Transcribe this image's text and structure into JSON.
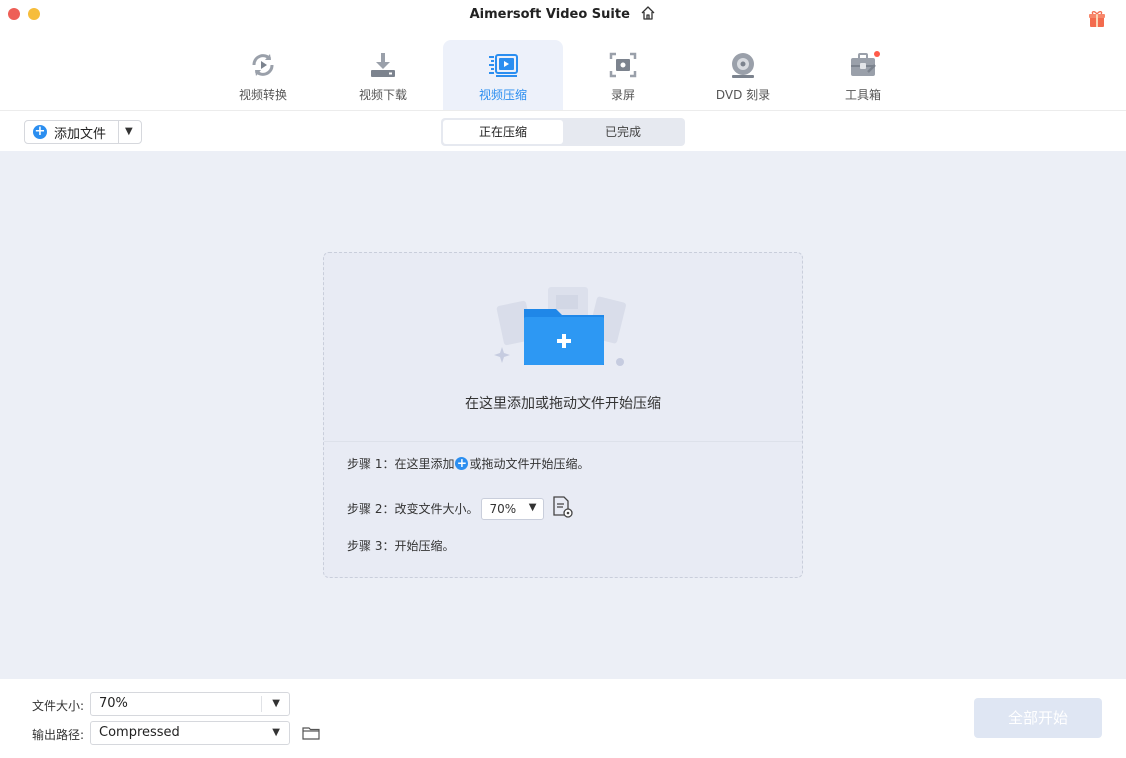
{
  "window": {
    "title": "Aimersoft Video Suite"
  },
  "nav": {
    "items": [
      {
        "label": "视频转换",
        "icon": "convert-icon",
        "active": false
      },
      {
        "label": "视频下载",
        "icon": "download-icon",
        "active": false
      },
      {
        "label": "视频压缩",
        "icon": "compress-icon",
        "active": true
      },
      {
        "label": "录屏",
        "icon": "screen-record-icon",
        "active": false
      },
      {
        "label": "DVD 刻录",
        "icon": "disc-icon",
        "active": false
      },
      {
        "label": "工具箱",
        "icon": "toolbox-icon",
        "active": false,
        "badge": true
      }
    ]
  },
  "toolbar": {
    "add_file_label": "添加文件",
    "tabs": [
      "正在压缩",
      "已完成"
    ],
    "active_tab": "正在压缩"
  },
  "dropzone": {
    "hint": "在这里添加或拖动文件开始压缩",
    "step1_prefix": "步骤 1：在这里添加",
    "step1_suffix": "或拖动文件开始压缩。",
    "step2_label": "步骤 2：改变文件大小。",
    "step2_value": "70%",
    "step3_label": "步骤 3：开始压缩。"
  },
  "footer": {
    "file_size_label": "文件大小:",
    "file_size_value": "70%",
    "output_path_label": "输出路径:",
    "output_path_value": "Compressed",
    "start_all_label": "全部开始"
  },
  "colors": {
    "accent": "#2b8ef0",
    "content_bg": "#eceff6",
    "badge": "#ff5b4a",
    "disabled_button": "#dfe6f3"
  }
}
